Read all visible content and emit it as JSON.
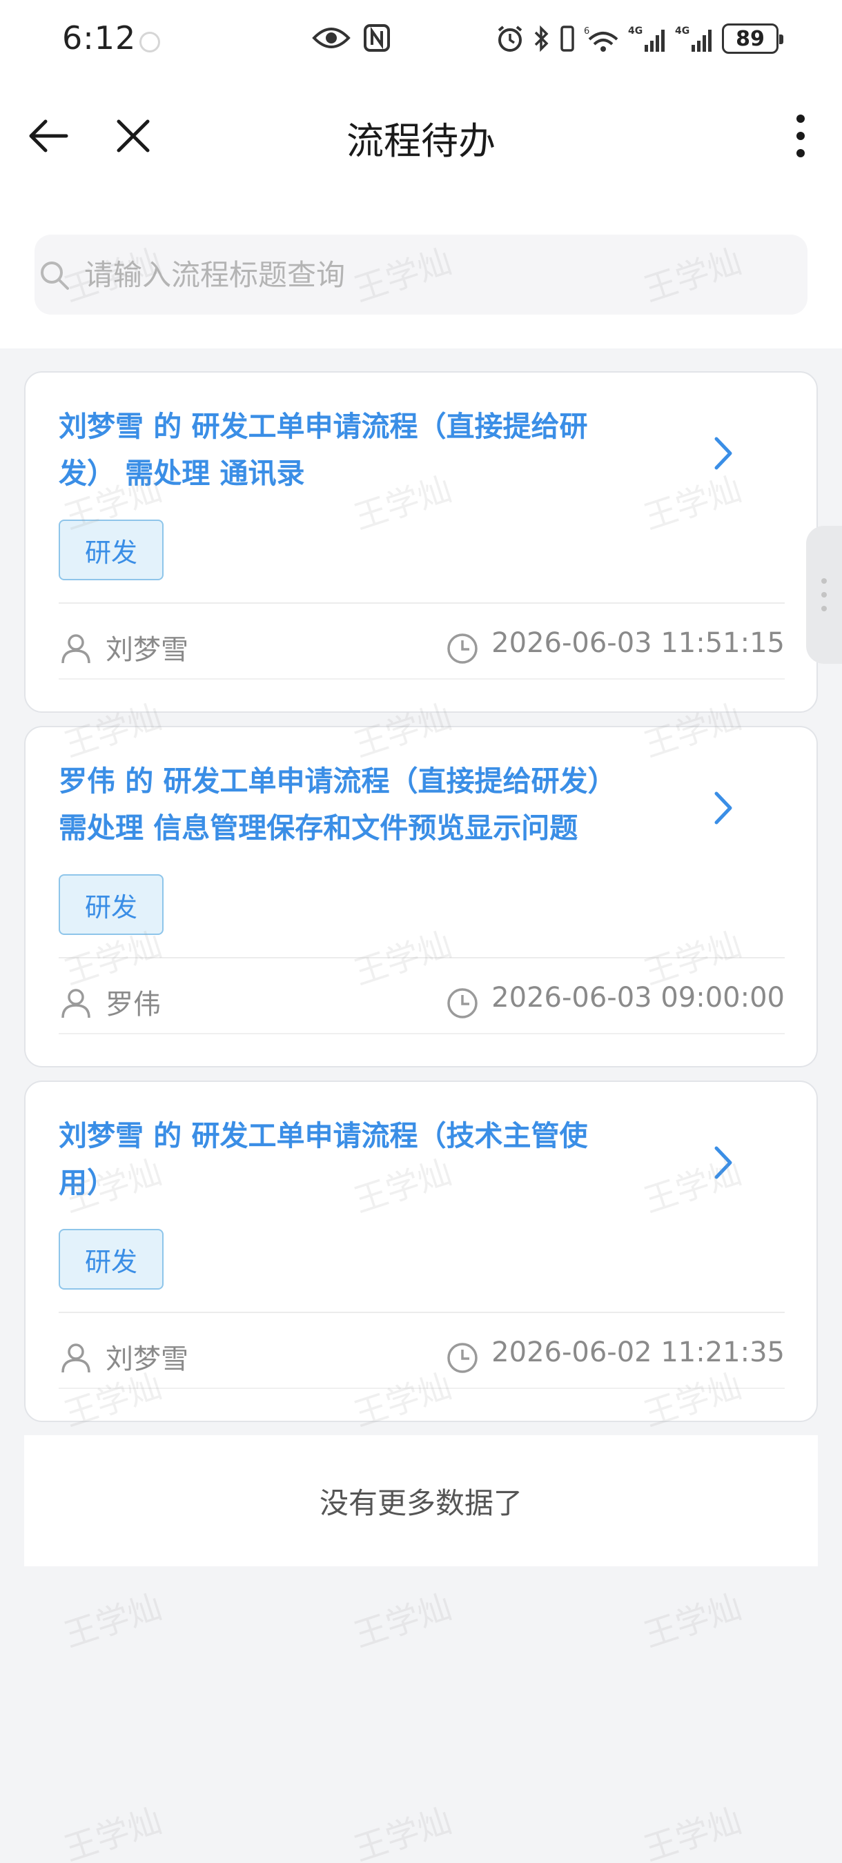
{
  "status_bar": {
    "time": "6:12",
    "battery": "89",
    "network_1": "4G",
    "network_2": "4G",
    "wifi_label": "6"
  },
  "nav": {
    "title": "流程待办",
    "back_icon": "arrow-left-icon",
    "close_icon": "close-icon",
    "more_icon": "more-vertical-icon"
  },
  "search": {
    "placeholder": "请输入流程标题查询",
    "value": ""
  },
  "cards": [
    {
      "title_line1": "刘梦雪 的 研发工单申请流程（直接提给研",
      "title_line2": "发） 需处理 通讯录",
      "tag": "研发",
      "user": "刘梦雪",
      "time": "2026-06-03 11:51:15"
    },
    {
      "title_line1": "罗伟 的 研发工单申请流程（直接提给研发）",
      "title_line2": "需处理 信息管理保存和文件预览显示问题",
      "tag": "研发",
      "user": "罗伟",
      "time": "2026-06-03 09:00:00"
    },
    {
      "title_line1": "刘梦雪 的 研发工单申请流程（技术主管使",
      "title_line2": "用）",
      "tag": "研发",
      "user": "刘梦雪",
      "time": "2026-06-02 11:21:35"
    }
  ],
  "footer": {
    "no_more": "没有更多数据了"
  },
  "watermark": "王学灿",
  "colors": {
    "accent": "#3a8ee6",
    "tag_bg": "#e3f2fb",
    "tag_border": "#8ec5ea",
    "page_bg": "#f3f4f6",
    "meta_text": "#8a8a8a"
  }
}
